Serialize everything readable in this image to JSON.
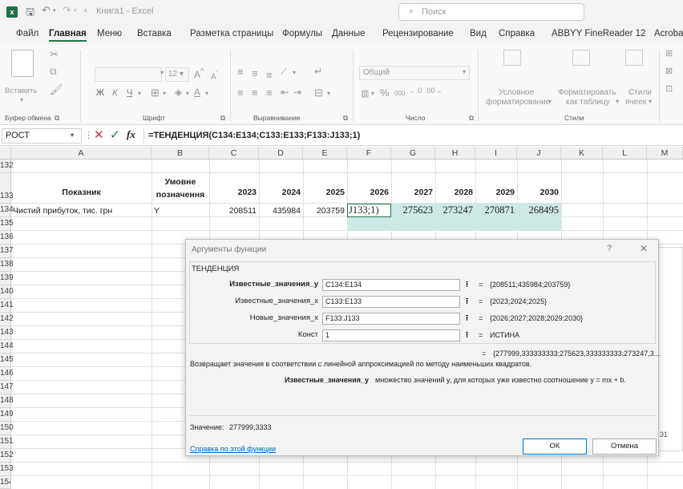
{
  "title_bar": {
    "file_name": "Книга1",
    "separator": "-",
    "app_name": "Excel",
    "search_placeholder": "Поиск"
  },
  "menu": [
    "Файл",
    "Главная",
    "Меню",
    "Вставка",
    "Разметка страницы",
    "Формулы",
    "Данные",
    "Рецензирование",
    "Вид",
    "Справка",
    "ABBYY FineReader 12",
    "Acroba"
  ],
  "ribbon": {
    "paste": "Вставить",
    "clipboard_group": "Буфер обмена",
    "font_size": "12",
    "font_group": "Шрифт",
    "bold": "Ж",
    "italic": "К",
    "underline": "Ч",
    "align_group": "Выравнивание",
    "number_format": "Общий",
    "percent": "%",
    "thousands": "000",
    "number_group": "Число",
    "conditional": [
      "Условное",
      "форматирование"
    ],
    "format_table": [
      "Форматировать",
      "как таблицу"
    ],
    "cell_styles": [
      "Стили",
      "ячеек"
    ],
    "styles_group": "Стили"
  },
  "formula_bar": {
    "name_box": "РОСТ",
    "fx": "fx",
    "formula": "=ТЕНДЕНЦИЯ(C134:E134;C133:E133;F133:J133;1)"
  },
  "columns": [
    "A",
    "B",
    "C",
    "D",
    "E",
    "F",
    "G",
    "H",
    "I",
    "J",
    "K",
    "L",
    "M"
  ],
  "rows": [
    "132",
    "133",
    "134",
    "135",
    "136",
    "137",
    "138",
    "139",
    "140",
    "141",
    "142",
    "143",
    "144",
    "145",
    "146",
    "147",
    "148",
    "149",
    "150",
    "151",
    "152",
    "153",
    "154"
  ],
  "cells": {
    "a133": "Показник",
    "b133_1": "Умовне",
    "b133_2": "позначення",
    "c133": "2023",
    "d133": "2024",
    "e133": "2025",
    "f133": "2026",
    "g133": "2027",
    "h133": "2028",
    "i133": "2029",
    "j133": "2030",
    "a134": "Чистий прибуток, тис. грн",
    "b134": "Y",
    "c134": "208511",
    "d134": "435984",
    "e134": "203759",
    "f134": "J133;1)",
    "g134": "275623",
    "h134": "273247",
    "i134": "270871",
    "j134": "268495",
    "m150": "31"
  },
  "dialog": {
    "title": "Аргументы функции",
    "help_q": "?",
    "close": "✕",
    "function_name": "ТЕНДЕНЦИЯ",
    "args": [
      {
        "label": "Известные_значения_y",
        "value": "C134:E134",
        "result": "{208511;435984;203759}"
      },
      {
        "label": "Известные_значения_x",
        "value": "C133:E133",
        "result": "{2023;2024;2025}"
      },
      {
        "label": "Новые_значения_x",
        "value": "F133:J133",
        "result": "{2026;2027;2028;2029;2030}"
      },
      {
        "label": "Конст",
        "value": "1",
        "result": "ИСТИНА"
      }
    ],
    "eq": "=",
    "total_result": "{277999,333333333;275623,333333333;273247,3...",
    "description": "Возвращает значения в соответствии с линейной аппроксимацией по методу наименьших квадратов.",
    "arg_help_name": "Известные_значения_y",
    "arg_help_text": "множество значений y, для которых уже известно соотношение y = mx + b.",
    "value_label": "Значение:",
    "value": "277999,3333",
    "help_link": "Справка по этой функции",
    "ok": "ОК",
    "cancel": "Отмена"
  },
  "colors": {
    "excel_green": "#217346",
    "selection_teal": "#cce9e6",
    "header_gray": "#f0f0f0"
  }
}
